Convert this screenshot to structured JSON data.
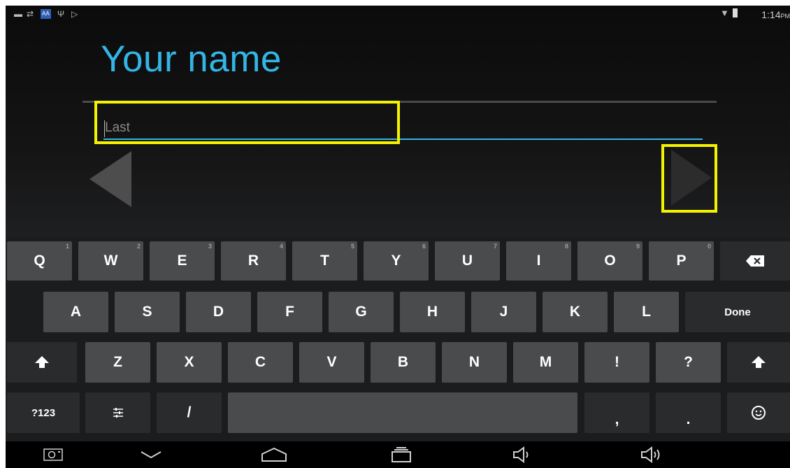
{
  "status_bar": {
    "time": "1:14",
    "ampm": "PM",
    "left_icons": [
      "screenshot-icon",
      "sync-icon",
      "keyboard-badge-icon",
      "usb-icon",
      "play-store-icon"
    ],
    "right_icons": [
      "wifi-icon",
      "battery-icon"
    ]
  },
  "setup": {
    "title": "Your name",
    "input_placeholder": "Last",
    "input_value": "",
    "back_icon": "back-arrow-icon",
    "next_icon": "next-arrow-icon",
    "highlight_color": "#f5f200",
    "accent_color": "#33b5e5"
  },
  "keyboard": {
    "row1": [
      {
        "label": "Q",
        "hint": "1"
      },
      {
        "label": "W",
        "hint": "2"
      },
      {
        "label": "E",
        "hint": "3"
      },
      {
        "label": "R",
        "hint": "4"
      },
      {
        "label": "T",
        "hint": "5"
      },
      {
        "label": "Y",
        "hint": "6"
      },
      {
        "label": "U",
        "hint": "7"
      },
      {
        "label": "I",
        "hint": "8"
      },
      {
        "label": "O",
        "hint": "9"
      },
      {
        "label": "P",
        "hint": "0"
      }
    ],
    "row2": [
      "A",
      "S",
      "D",
      "F",
      "G",
      "H",
      "J",
      "K",
      "L"
    ],
    "done_label": "Done",
    "row3": [
      "Z",
      "X",
      "C",
      "V",
      "B",
      "N",
      "M",
      "!",
      "?"
    ],
    "symbols_label": "?123",
    "slash_label": "/",
    "comma_label": ",",
    "period_label": ".",
    "backspace_icon": "backspace-icon",
    "shift_icon": "shift-icon",
    "settings_icon": "keyboard-settings-icon",
    "emoji_icon": "emoji-icon"
  },
  "nav_bar": {
    "icons": [
      "camera-icon",
      "hide-keyboard-icon",
      "home-icon",
      "recent-apps-icon",
      "volume-down-icon",
      "volume-up-icon"
    ]
  }
}
